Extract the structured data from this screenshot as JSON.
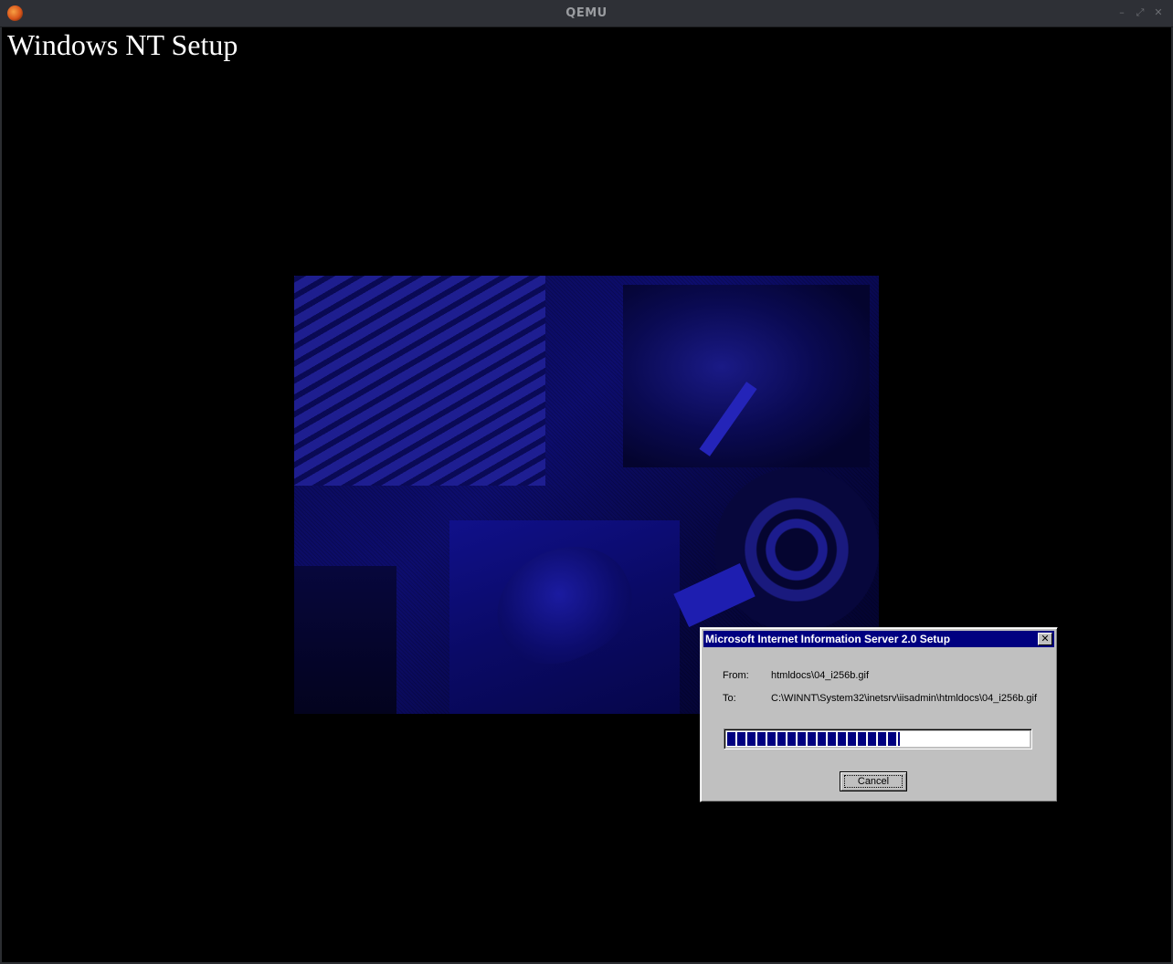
{
  "window": {
    "title": "QEMU",
    "controls": [
      "minimize",
      "maximize",
      "close"
    ],
    "icons": {
      "minimize": "–",
      "maximize": "⤢",
      "close": "✕"
    }
  },
  "screen": {
    "setup_title": "Windows NT Setup"
  },
  "dialog": {
    "title": "Microsoft Internet Information Server 2.0 Setup",
    "close_glyph": "✕",
    "from_label": "From:",
    "from_value": "htmldocs\\04_i256b.gif",
    "to_label": "To:",
    "to_value": "C:\\WINNT\\System32\\inetsrv\\iisadmin\\htmldocs\\04_i256b.gif",
    "progress_fraction": 0.57,
    "cancel_label": "Cancel"
  },
  "colors": {
    "titlebar_bg": "#2e3036",
    "screen_bg": "#000000",
    "dialog_bg": "#c0c0c0",
    "dialog_title_bg": "#000080",
    "progress_fill": "#000080"
  }
}
